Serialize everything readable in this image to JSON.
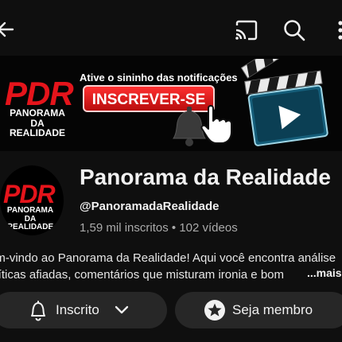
{
  "topbar": {
    "back_icon": "arrow-left-icon",
    "cast_icon": "cast-icon",
    "search_icon": "search-icon",
    "more_icon": "more-vert-icon"
  },
  "banner": {
    "logo_text": "PDR",
    "logo_sub_line1": "PANORAMA DA",
    "logo_sub_line2": "REALIDADE",
    "notification_text": "Ative o sininho das notificações",
    "subscribe_text": "INSCREVER-SE",
    "bell_icon": "bell-icon",
    "pointer_icon": "hand-pointer-icon",
    "clapper_icon": "clapperboard-play-icon"
  },
  "channel": {
    "avatar_logo": "PDR",
    "avatar_sub_line1": "PANORAMA DA",
    "avatar_sub_line2": "REALIDADE",
    "name": "Panorama da Realidade",
    "handle": "@PanoramadaRealidade",
    "subscribers": "1,59 mil inscritos",
    "separator": "•",
    "videos": "102 vídeos"
  },
  "description": {
    "line1": "em-vindo ao Panorama da Realidade! Aqui você encontra análise",
    "line2": "olíticas afiadas, comentários que misturam ironia e bom",
    "more": "...mais"
  },
  "actions": {
    "subscribed_label": "Inscrito",
    "member_label": "Seja membro",
    "bell_icon": "bell-icon",
    "chevron_icon": "chevron-down-icon",
    "star_icon": "star-badge-icon"
  },
  "colors": {
    "background": "#0f0f0f",
    "pill": "#272727",
    "brand_red": "#e5141b"
  }
}
